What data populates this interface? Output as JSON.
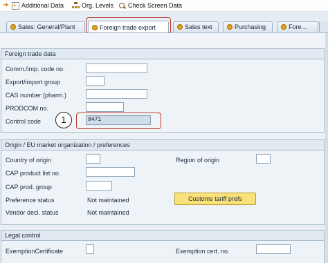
{
  "toolbar": {
    "additional_data": "Additional Data",
    "org_levels": "Org. Levels",
    "check_screen_data": "Check Screen Data"
  },
  "tabs": [
    {
      "label": "Sales: General/Plant"
    },
    {
      "label": "Foreign trade export"
    },
    {
      "label": "Sales text"
    },
    {
      "label": "Purchasing"
    },
    {
      "label": "Fore..."
    }
  ],
  "foreign_trade": {
    "title": "Foreign trade data",
    "comm_imp_code_label": "Comm./imp. code no.",
    "export_import_group_label": "Export/import group",
    "cas_number_label": "CAS number (pharm.)",
    "prodcom_label": "PRODCOM no.",
    "control_code_label": "Control code",
    "control_code_value": "8471"
  },
  "origin": {
    "title": "Origin / EU market organization / preferences",
    "country_of_origin_label": "Country of origin",
    "region_of_origin_label": "Region of origin",
    "cap_product_list_label": "CAP product list no.",
    "cap_prod_group_label": "CAP prod. group",
    "preference_status_label": "Preference status",
    "preference_status_value": "Not maintained",
    "vendor_decl_status_label": "Vendor decl. status",
    "vendor_decl_status_value": "Not maintained",
    "customs_tariff_button": "Customs tariff prefs"
  },
  "legal": {
    "title": "Legal control",
    "exemption_certificate_label": "ExemptionCertificate",
    "exemption_cert_no_label": "Exemption cert. no."
  },
  "annotation": {
    "callout_number": "1",
    "highlight_color": "#c0392b"
  }
}
